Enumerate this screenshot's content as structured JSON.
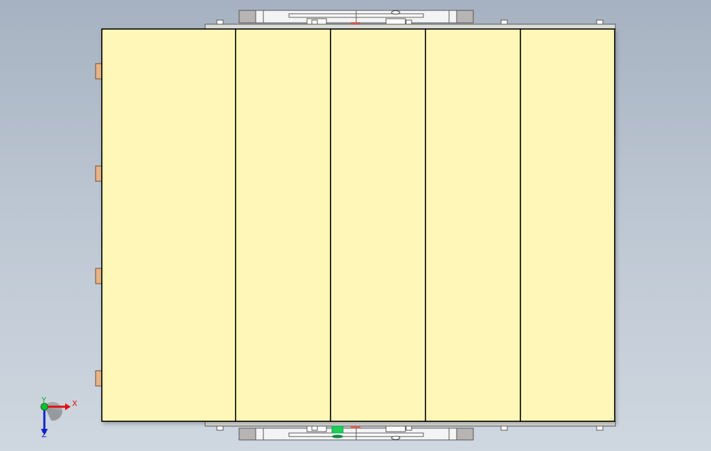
{
  "viewport": {
    "background_top": "#a6b2c1",
    "background_bottom": "#cfd7e0"
  },
  "assembly": {
    "panel_fill": "#fff7b8",
    "panel_stroke": "#000000",
    "panel_count": 5,
    "rail_fill": "#dcdcd8",
    "clip_fill": "#e8b48a",
    "clip_count": 4,
    "fastener_fill": "#ffffff"
  },
  "triad": {
    "x_label": "X",
    "y_label": "Y",
    "z_label": "Z",
    "x_color": "#e01010",
    "y_color": "#10b020",
    "z_color": "#1020d0"
  }
}
